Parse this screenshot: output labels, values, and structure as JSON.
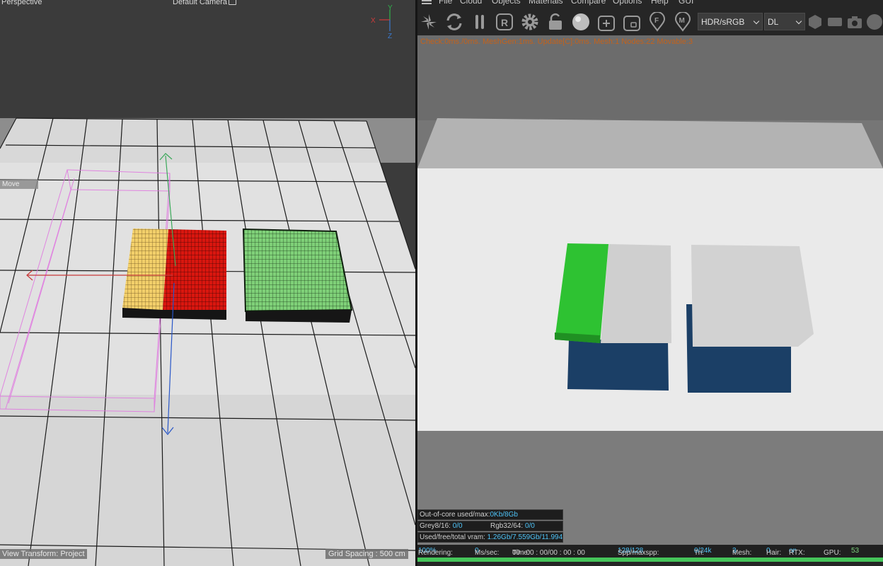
{
  "viewport": {
    "title": "Perspective",
    "camera": "Default Camera",
    "axis_labels": {
      "x": "X",
      "y": "Y",
      "z": "Z"
    },
    "move_tag": "Move",
    "view_transform": "View Transform: Project",
    "grid_spacing": "Grid Spacing : 500 cm",
    "colors": {
      "background": "#3b3b3b",
      "floor": "#e1e1e1",
      "yellow_block": "#f2cf6a",
      "red_block": "#d9160f",
      "green_block": "#7fd078",
      "selection": "#e07ae0"
    }
  },
  "octane": {
    "menu": [
      "File",
      "Cloud",
      "Objects",
      "Materials",
      "Compare",
      "Options",
      "Help",
      "GUI"
    ],
    "toolbar_icons": [
      "send-scene-icon",
      "restart-render-icon",
      "pause-render-icon",
      "region-render-icon",
      "settings-gear-icon",
      "lock-icon",
      "material-ball-icon",
      "add-icon",
      "focus-pick-icon",
      "focus-icon",
      "material-pick-icon",
      "cube-icon",
      "film-icon",
      "camera-icon",
      "sphere-icon"
    ],
    "color_space": "HDR/sRGB",
    "kernel": "DL",
    "stats_line": "Check:0ms./0ms. MeshGen:1ms. Update[C]:0ms. Mesh:1 Nodes:22 Movable:3",
    "info": {
      "out_of_core_label": "Out-of-core used/max:",
      "out_of_core_value": "0Kb/8Gb",
      "grey_label": "Grey8/16:",
      "grey_value": "0/0",
      "rgb_label": "Rgb32/64:",
      "rgb_value": "0/0",
      "vram_label": "Used/free/total vram:",
      "vram_value": "1.26Gb/7.559Gb/11.994"
    },
    "status": {
      "rendering_label": "Rendering:",
      "rendering_value": "100%",
      "ms_label": "Ms/sec:",
      "ms_value": "0",
      "time_label": "Time:",
      "time_value": "00 : 00 : 00/00 : 00 : 00",
      "spp_label": "Spp/maxspp:",
      "spp_value": "128/128",
      "tri_label": "Tri:",
      "tri_value": "0/24k",
      "mesh_label": "Mesh:",
      "mesh_value": "3",
      "hair_label": "Hair:",
      "hair_value": "0",
      "rtx_label": "RTX:",
      "rtx_value": "on",
      "gpu_label": "GPU:",
      "gpu_value": "53"
    },
    "progress": 1.0,
    "colors": {
      "status_accent": "#4fc3f7",
      "stats_line": "#c4621b",
      "green_object": "#2ec232",
      "shadow_blue": "#1b3f66"
    }
  }
}
